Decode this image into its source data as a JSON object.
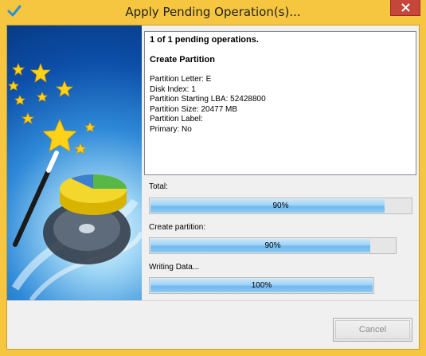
{
  "window": {
    "title": "Apply Pending Operation(s)...",
    "title_icon": "checkmark-icon",
    "close_icon": "close-icon"
  },
  "illustration": {
    "icons": [
      "magic-wand-icon",
      "star-icon",
      "pie-chart-icon",
      "hard-disk-icon"
    ]
  },
  "details": {
    "summary": "1 of 1 pending operations.",
    "operation": "Create Partition",
    "lines": [
      "Partition Letter: E",
      "Disk Index: 1",
      "Partition Starting LBA: 52428800",
      "Partition Size: 20477 MB",
      "Partition Label:",
      "Primary: No"
    ]
  },
  "progress": {
    "total": {
      "label": "Total:",
      "text": "90%",
      "value": 0.9
    },
    "create": {
      "label": "Create partition:",
      "text": "90%",
      "value": 0.9
    },
    "writing": {
      "label": "Writing Data...",
      "text": "100%",
      "value": 1.0
    }
  },
  "buttons": {
    "cancel": "Cancel"
  },
  "colors": {
    "title_bar": "#f6c640",
    "close_button": "#c7463b",
    "progress_fill": "#8ccbf4"
  }
}
